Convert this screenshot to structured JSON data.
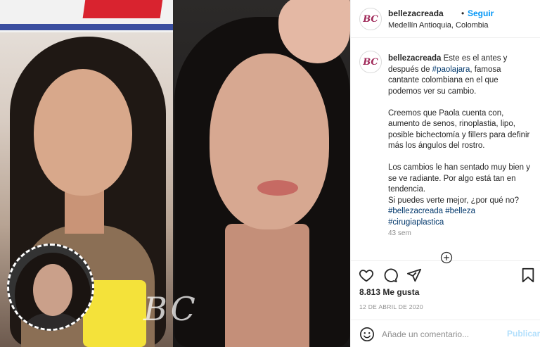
{
  "account": {
    "username": "bellezacreada",
    "separator": "•",
    "follow_label": "Seguir",
    "location": "Medellín Antioquia, Colombia",
    "avatar_monogram": "BC"
  },
  "caption": {
    "username": "bellezacreada",
    "line1_text": "Este es el antes y después de",
    "line1_tag": "#paolajara",
    "line1_rest": ", famosa cantante colombiana en el que podemos ver su cambio.",
    "paragraph2": "Creemos que Paola cuenta con, aumento de senos, rinoplastia, lipo, posible bichectomía y fillers para definir más los ángulos del rostro.",
    "paragraph3": "Los cambios le han sentado muy bien y se ve radiante. Por algo está tan en tendencia.",
    "paragraph4": "Si puedes verte mejor, ¿por qué no?",
    "hashtags": [
      "#bellezacreada",
      "#belleza",
      "#cirugiaplastica"
    ],
    "time_ago": "43 sem"
  },
  "actions": {
    "icons": [
      "heart-icon",
      "comment-icon",
      "share-icon",
      "bookmark-icon"
    ]
  },
  "stats": {
    "likes": "8.813 Me gusta",
    "date": "12 DE ABRIL DE 2020"
  },
  "comment_box": {
    "placeholder": "Añade un comentario...",
    "post_label": "Publicar"
  },
  "media": {
    "watermark": "BC"
  },
  "colors": {
    "link_blue": "#0095f6",
    "hashtag": "#00376b",
    "muted": "#8e8e8e",
    "post_disabled": "#b2dffc",
    "brand": "#a02a5a"
  }
}
